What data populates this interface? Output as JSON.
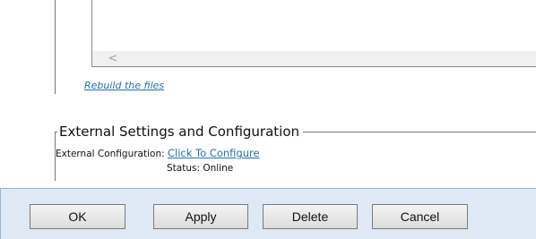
{
  "files": {
    "scroll_left_glyph": "<",
    "rebuild_link": "Rebuild the files"
  },
  "external": {
    "legend": "External Settings and Configuration",
    "config_label": "External Configuration:",
    "config_link": "Click To Configure",
    "status_label": "Status:",
    "status_value": "Online"
  },
  "buttons": {
    "ok": "OK",
    "apply": "Apply",
    "delete": "Delete",
    "cancel": "Cancel"
  },
  "colors": {
    "link": "#2a6fb0",
    "button_bar_bg": "#dfe9f5"
  }
}
